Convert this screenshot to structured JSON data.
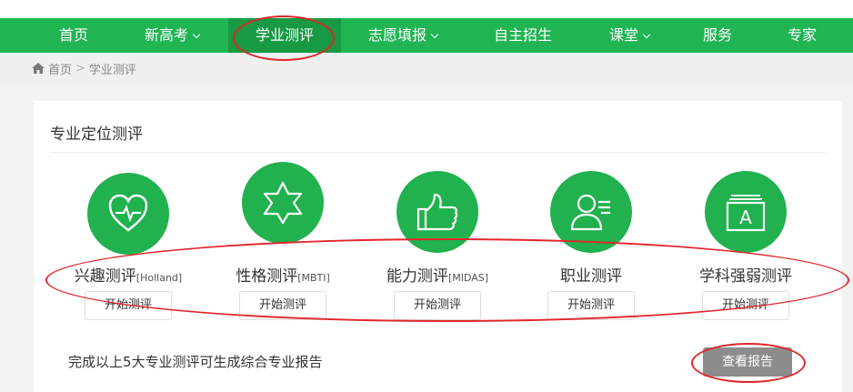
{
  "nav": {
    "items": [
      {
        "label": "首页",
        "caret": false
      },
      {
        "label": "新高考",
        "caret": true
      },
      {
        "label": "学业测评",
        "caret": false,
        "active": true
      },
      {
        "label": "志愿填报",
        "caret": true
      },
      {
        "label": "自主招生",
        "caret": false
      },
      {
        "label": "课堂",
        "caret": true
      },
      {
        "label": "服务",
        "caret": false
      },
      {
        "label": "专家",
        "caret": false
      }
    ]
  },
  "breadcrumb": {
    "home": "首页",
    "separator": ">",
    "current": "学业测评"
  },
  "card": {
    "title": "专业定位测评",
    "tests": [
      {
        "name": "兴趣测评",
        "tag": "[Holland]",
        "button": "开始测评",
        "icon": "heart-pulse-icon"
      },
      {
        "name": "性格测评",
        "tag": "[MBTI]",
        "button": "开始测评",
        "icon": "star-of-david-icon"
      },
      {
        "name": "能力测评",
        "tag": "[MIDAS]",
        "button": "开始测评",
        "icon": "thumbs-up-icon"
      },
      {
        "name": "职业测评",
        "tag": "",
        "button": "开始测评",
        "icon": "person-card-icon"
      },
      {
        "name": "学科强弱测评",
        "tag": "",
        "button": "开始测评",
        "icon": "stacked-pages-icon"
      }
    ],
    "footer_text": "完成以上5大专业测评可生成综合专业报告",
    "report_button": "查看报告"
  },
  "colors": {
    "nav_bg": "#20b453",
    "nav_active": "#179a43",
    "icon_circle": "#21b14e",
    "annotation": "#e0262b",
    "report_btn": "#8c8c8c"
  }
}
